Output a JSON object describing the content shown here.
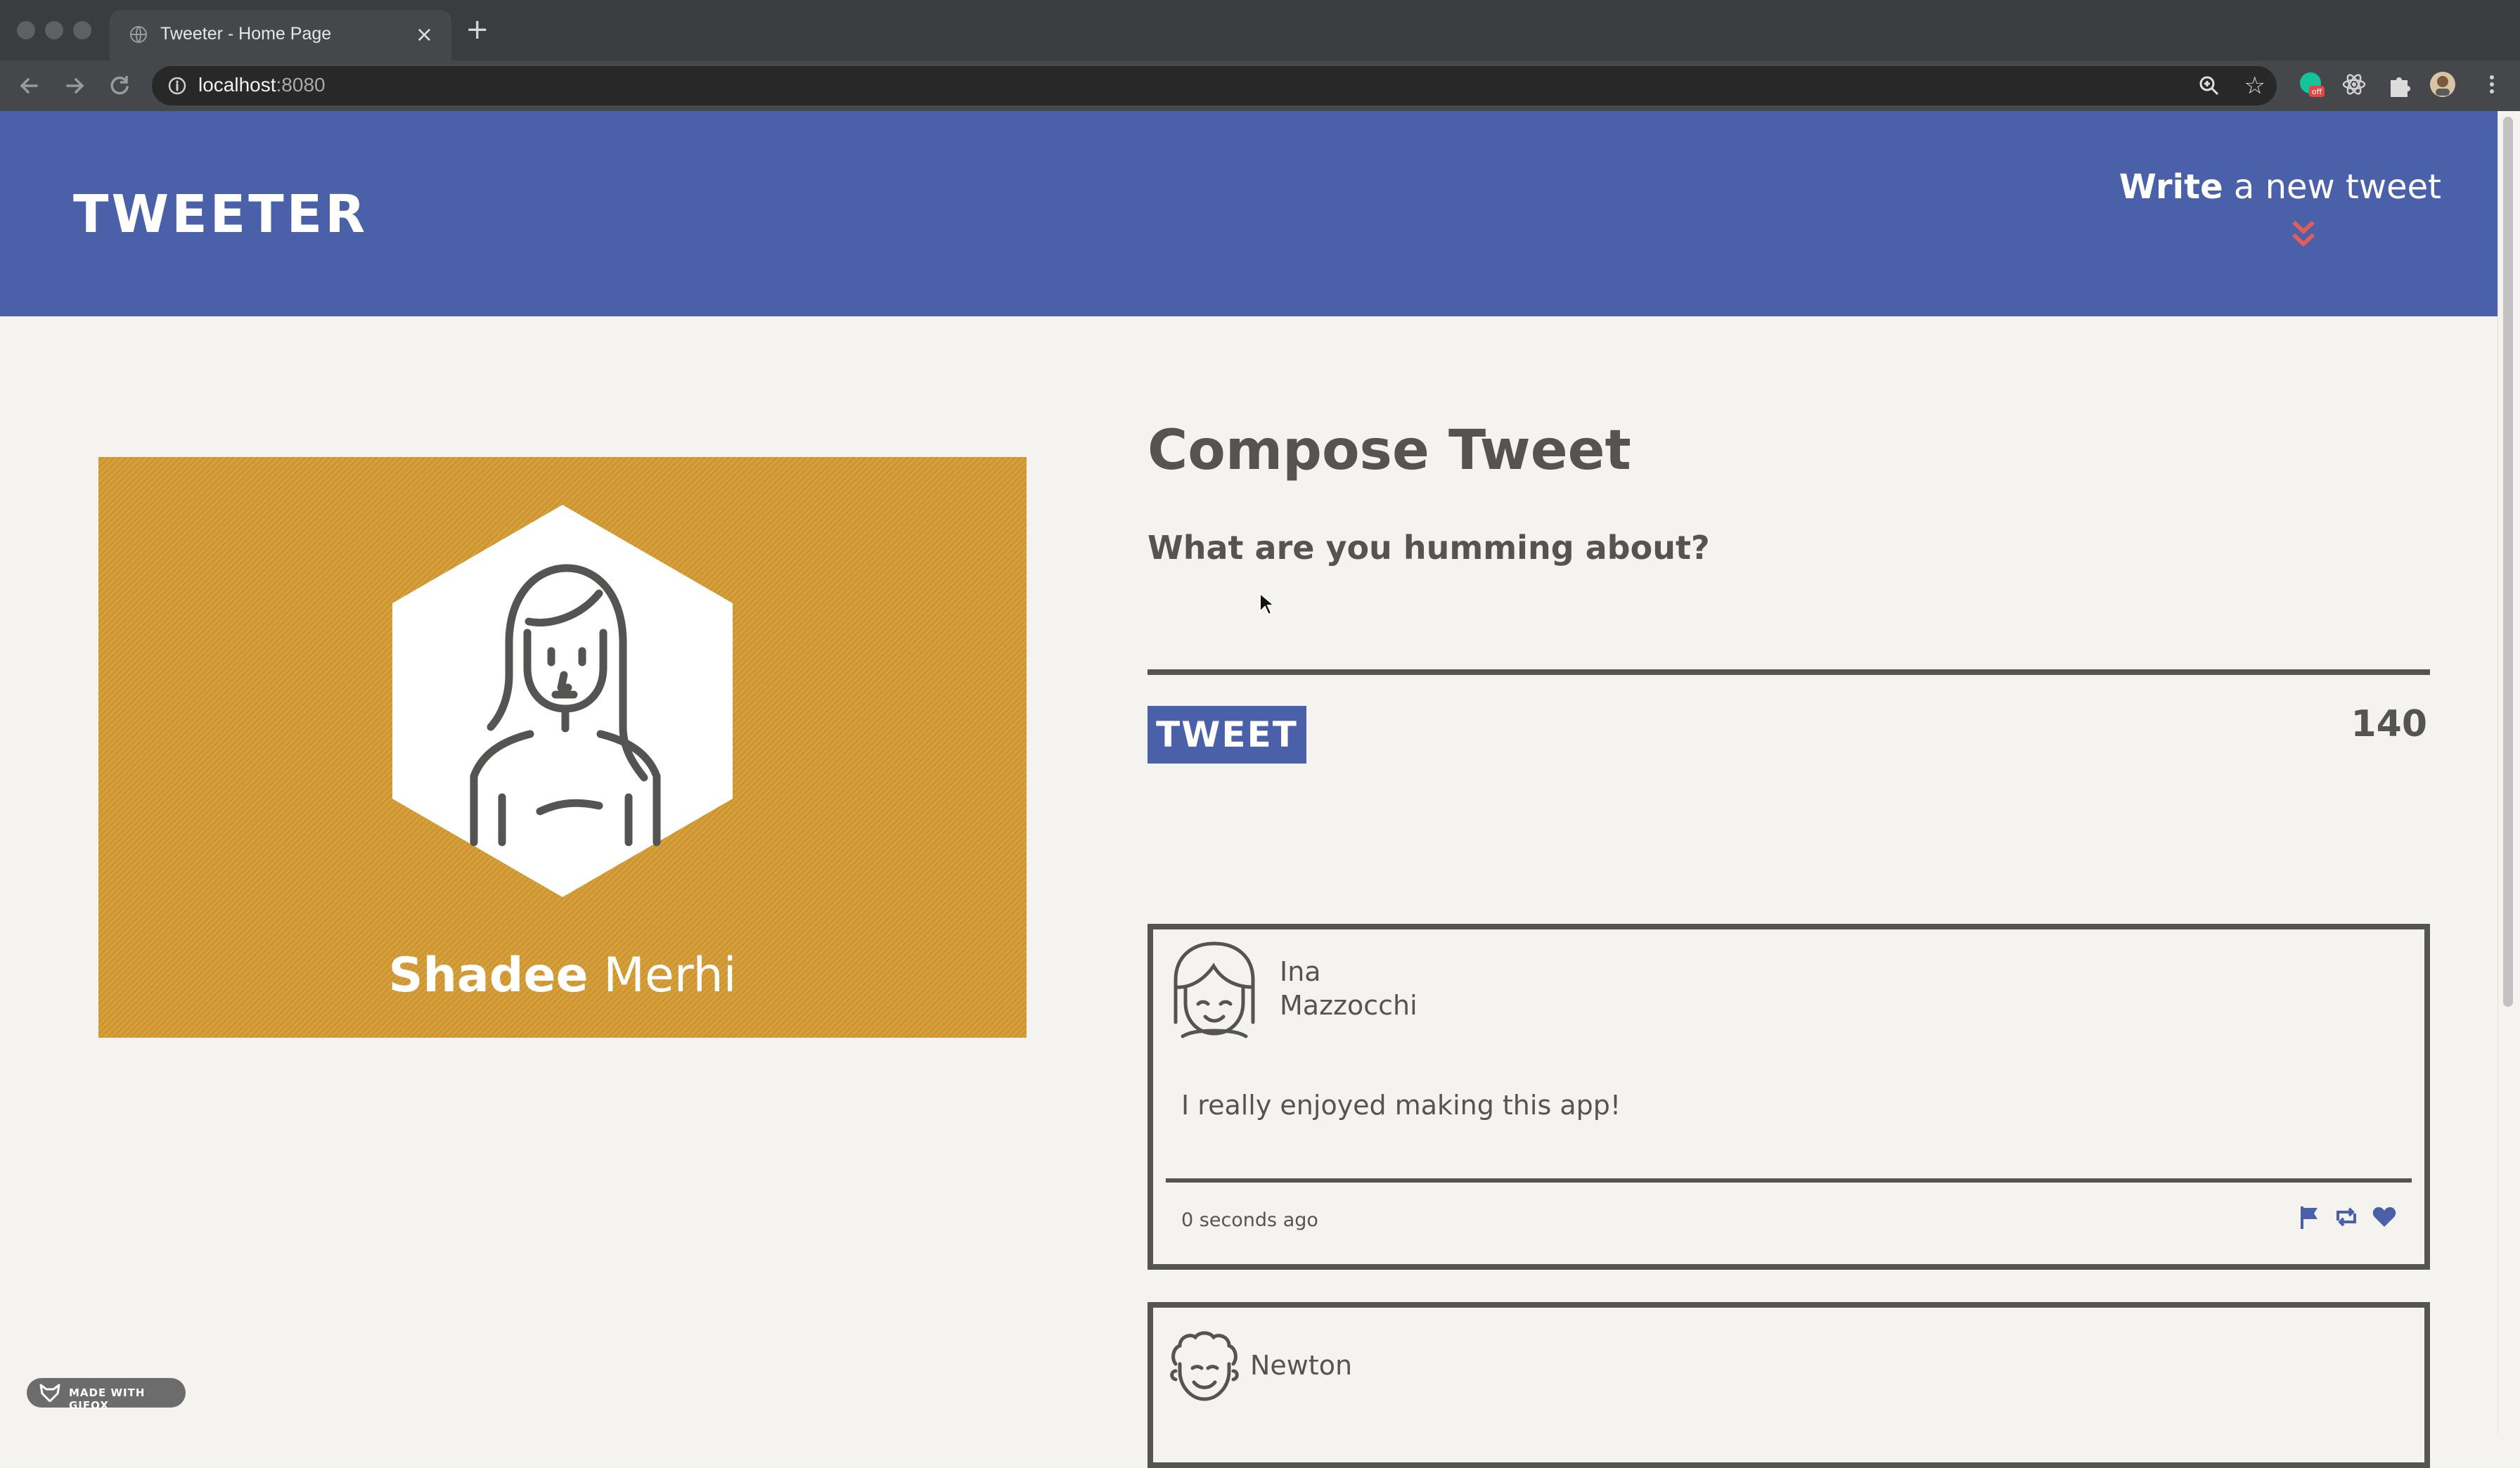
{
  "browser": {
    "tab_title": "Tweeter - Home Page",
    "tab_close": "×",
    "new_tab": "+",
    "url_host": "localhost",
    "url_port": ":8080",
    "extension_badge": "off"
  },
  "header": {
    "logo": "TWEETER",
    "write_bold": "Write",
    "write_rest": " a new tweet"
  },
  "profile": {
    "first_name": "Shadee",
    "last_name": " Merhi",
    "card_color": "#d49b33"
  },
  "compose": {
    "title": "Compose Tweet",
    "label": "What are you humming about?",
    "input_value": "",
    "button_label": "TWEET",
    "counter": "140"
  },
  "tweets": [
    {
      "name_line1": "Ina",
      "name_line2": "Mazzocchi",
      "content": "I really enjoyed making this app!",
      "time": "0 seconds ago",
      "icons": [
        "flag-icon",
        "retweet-icon",
        "heart-icon"
      ]
    },
    {
      "name_line1": "Newton",
      "name_line2": ""
    }
  ],
  "badge": {
    "label": "MADE WITH GIFOX"
  },
  "colors": {
    "header": "#4a60a9",
    "background": "#f4f3ef",
    "text": "#555451",
    "accent_chevron": "#e05d5d"
  }
}
